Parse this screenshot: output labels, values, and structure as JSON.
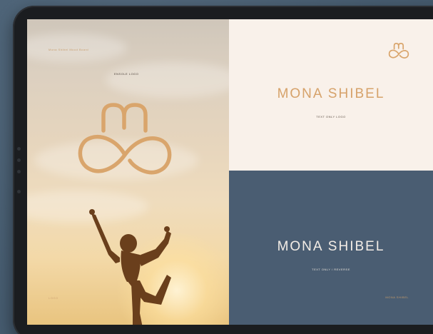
{
  "colors": {
    "background": "#4a6075",
    "accent_gold": "#d6a26a",
    "cream": "#f9f1ea",
    "slate": "#4a5d72"
  },
  "left_panel": {
    "header_text": "Mona Shibel Mood Board",
    "logo_label": "ENSOLE LOGO",
    "footer_text": "LOGO",
    "logo_icon": "mona-monogram-icon",
    "photo": "yoga-silhouette-photo"
  },
  "top_right": {
    "brand_name": "MONA SHIBEL",
    "caption": "TEXT ONLY LOGO",
    "logo_icon": "mona-monogram-icon"
  },
  "bottom_right": {
    "brand_name": "MONA SHIBEL",
    "caption": "TEXT ONLY / REVERSE",
    "footer_text": "MONA SHIBEL"
  }
}
